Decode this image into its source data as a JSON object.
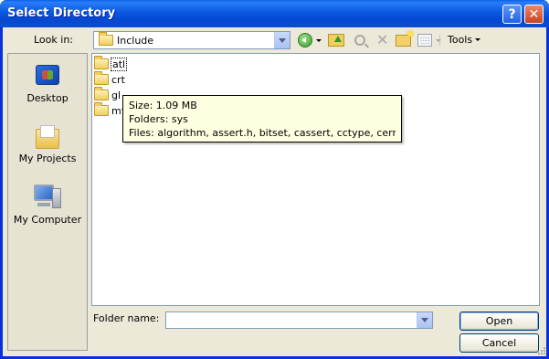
{
  "window": {
    "title": "Select Directory",
    "help_label": "?",
    "close_label": "✕"
  },
  "lookin": {
    "label": "Look in:",
    "value": "Include"
  },
  "toolbar": {
    "tools_label": "Tools",
    "icons": [
      "back-icon",
      "up-folder-icon",
      "search-web-icon",
      "delete-icon",
      "new-folder-icon",
      "views-icon"
    ]
  },
  "places": [
    {
      "label": "Desktop",
      "icon": "desktop-icon"
    },
    {
      "label": "My Projects",
      "icon": "my-projects-icon"
    },
    {
      "label": "My Computer",
      "icon": "my-computer-icon"
    }
  ],
  "files": [
    {
      "name": "atl"
    },
    {
      "name": "crt"
    },
    {
      "name": "gl"
    },
    {
      "name": "mfc"
    }
  ],
  "tooltip": {
    "size": "Size: 1.09 MB",
    "folders": "Folders: sys",
    "files": "Files: algorithm, assert.h, bitset, cassert, cctype, cerrno, ..."
  },
  "folder_name": {
    "label": "Folder name:",
    "value": ""
  },
  "buttons": {
    "open": "Open",
    "cancel": "Cancel"
  },
  "colors": {
    "title_bar": "#0a5fe8",
    "dialog_bg": "#ece9d8",
    "tooltip_bg": "#ffffe1",
    "close_button": "#c8421f"
  }
}
